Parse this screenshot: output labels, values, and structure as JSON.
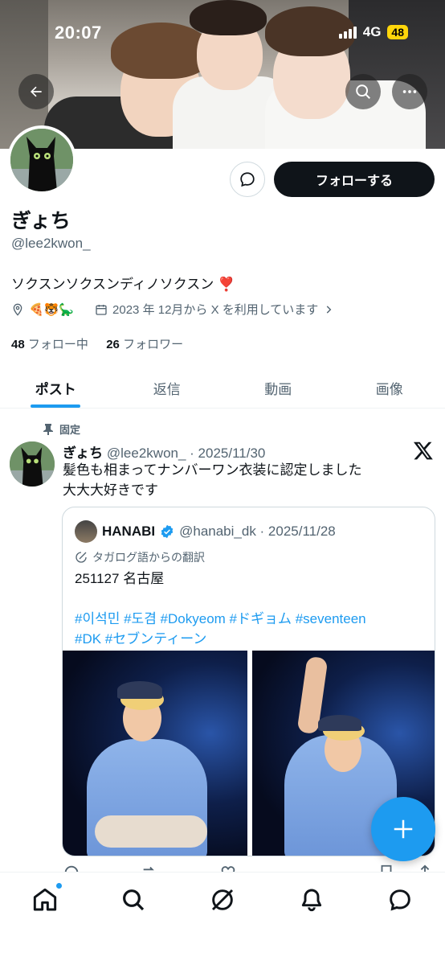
{
  "status_bar": {
    "time": "20:07",
    "network": "4G",
    "battery": "48",
    "battery_color": "#ffd60a"
  },
  "header": {
    "back_icon": "arrow-left-icon",
    "search_icon": "search-icon",
    "more_icon": "more-horizontal-icon"
  },
  "profile": {
    "display_name": "ぎょち",
    "handle": "@lee2kwon_",
    "bio": "ソクスンソクスンディノソクスン ❣️",
    "location_emojis": "🍕🐯🦕",
    "joined": "2023 年 12月から X を利用しています",
    "following_count": "48",
    "following_label": "フォロー中",
    "followers_count": "26",
    "followers_label": "フォロワー",
    "follow_button": "フォローする"
  },
  "tabs": [
    {
      "label": "ポスト",
      "active": true
    },
    {
      "label": "返信",
      "active": false
    },
    {
      "label": "動画",
      "active": false
    },
    {
      "label": "画像",
      "active": false
    }
  ],
  "post": {
    "pinned_label": "固定",
    "author_name": "ぎょち",
    "author_handle_date": "@lee2kwon_ · 2025/11/30",
    "text_line1": "髪色も相まってナンバーワン衣装に認定しました",
    "text_line2": "大大大好きです",
    "quote": {
      "author_name": "HANABI",
      "author_handle_date": "@hanabi_dk · 2025/11/28",
      "translation_label": "タガログ語からの翻訳",
      "text": "251127 名古屋",
      "hashtags_line1": "#이석민 #도겸 #Dokyeom #ドギョム #seventeen",
      "hashtags_line2": "#DK #セブンティーン"
    }
  },
  "colors": {
    "accent": "#1d9bf0",
    "text_primary": "#0f1419",
    "text_secondary": "#536471"
  },
  "bottom_nav": [
    {
      "icon": "home-icon",
      "active": true
    },
    {
      "icon": "search-icon"
    },
    {
      "icon": "grok-icon"
    },
    {
      "icon": "notifications-bell-icon"
    },
    {
      "icon": "messages-icon"
    }
  ]
}
